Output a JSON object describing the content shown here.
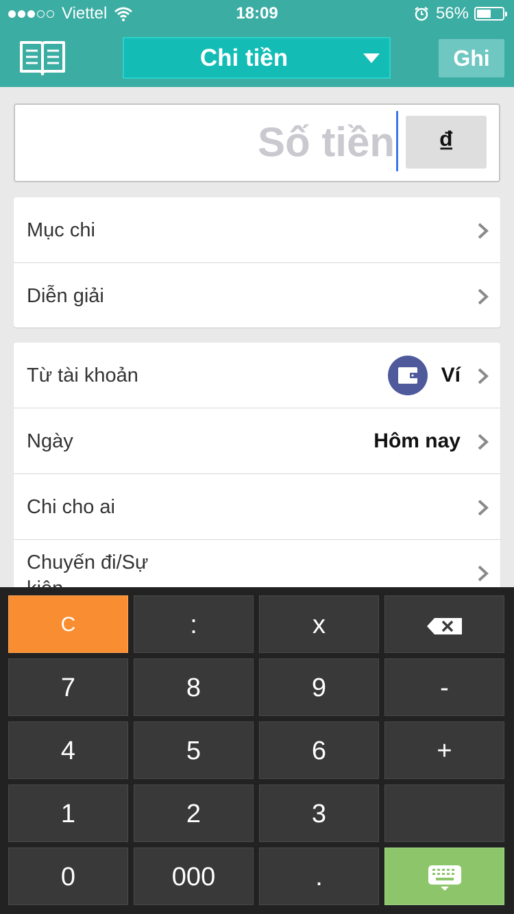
{
  "status_bar": {
    "carrier": "Viettel",
    "time": "18:09",
    "battery": "56%",
    "signal_bars_filled": 3,
    "signal_bars_total": 5,
    "battery_level": 0.56
  },
  "header": {
    "type_selector": "Chi tiền",
    "save_label": "Ghi"
  },
  "amount": {
    "placeholder": "Số tiền",
    "currency": "₫"
  },
  "fields_group_1": [
    {
      "label": "Mục chi"
    },
    {
      "label": "Diễn giải"
    }
  ],
  "fields_group_2": [
    {
      "label": "Từ tài khoản",
      "value": "Ví"
    },
    {
      "label": "Ngày",
      "value": "Hôm nay"
    },
    {
      "label": "Chi cho ai"
    },
    {
      "label": "Chuyến đi/Sự kiện"
    }
  ],
  "keypad": {
    "clear": "C",
    "divide": ":",
    "multiply": "x",
    "backspace_icon": "backspace-icon",
    "seven": "7",
    "eight": "8",
    "nine": "9",
    "minus": "-",
    "four": "4",
    "five": "5",
    "six": "6",
    "plus": "+",
    "one": "1",
    "two": "2",
    "three": "3",
    "zero": "0",
    "triple_zero": "000",
    "decimal": ".",
    "enter_icon": "keyboard-icon"
  },
  "colors": {
    "header": "#3bada3",
    "dropdown": "#14bcb6",
    "clear_key": "#f88d32",
    "enter_key": "#8dc66a",
    "caret": "#3a78e8",
    "wallet_icon": "#4e5a9c"
  }
}
